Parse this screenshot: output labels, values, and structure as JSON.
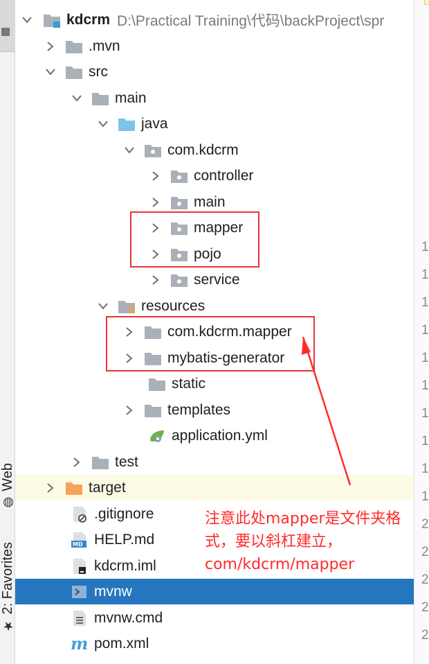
{
  "project": {
    "name": "kdcrm",
    "path": "D:\\Practical Training\\代码\\backProject\\spr"
  },
  "tree": {
    "mvn": ".mvn",
    "src": "src",
    "main": "main",
    "java": "java",
    "pkg": "com.kdcrm",
    "controller": "controller",
    "main_pkg": "main",
    "mapper": "mapper",
    "pojo": "pojo",
    "service": "service",
    "resources": "resources",
    "res_mapper": "com.kdcrm.mapper",
    "mybatis_generator": "mybatis-generator",
    "static": "static",
    "templates": "templates",
    "application_yml": "application.yml",
    "test": "test",
    "target": "target",
    "gitignore": ".gitignore",
    "help_md": "HELP.md",
    "kdcrm_iml": "kdcrm.iml",
    "mvnw": "mvnw",
    "mvnw_cmd": "mvnw.cmd",
    "pom_xml": "pom.xml"
  },
  "side_tabs": {
    "web": "Web",
    "favorites": "2: Favorites"
  },
  "gutter": {
    "numbers": [
      "1",
      "1",
      "1",
      "1",
      "1",
      "1",
      "1",
      "1",
      "1",
      "1",
      "2",
      "2",
      "2",
      "2",
      "2"
    ]
  },
  "annotation": {
    "line1": "注意此处mapper是文件夹格",
    "line2": "式，要以斜杠建立，",
    "line3": "com/kdcrm/mapper"
  },
  "colors": {
    "selection": "#2675bf",
    "annotation_red": "#ff2a2a",
    "box_red": "#e8333a",
    "folder_gray": "#a9b0b8",
    "folder_blue": "#7cc4e8",
    "target_orange": "#f4a35c"
  }
}
